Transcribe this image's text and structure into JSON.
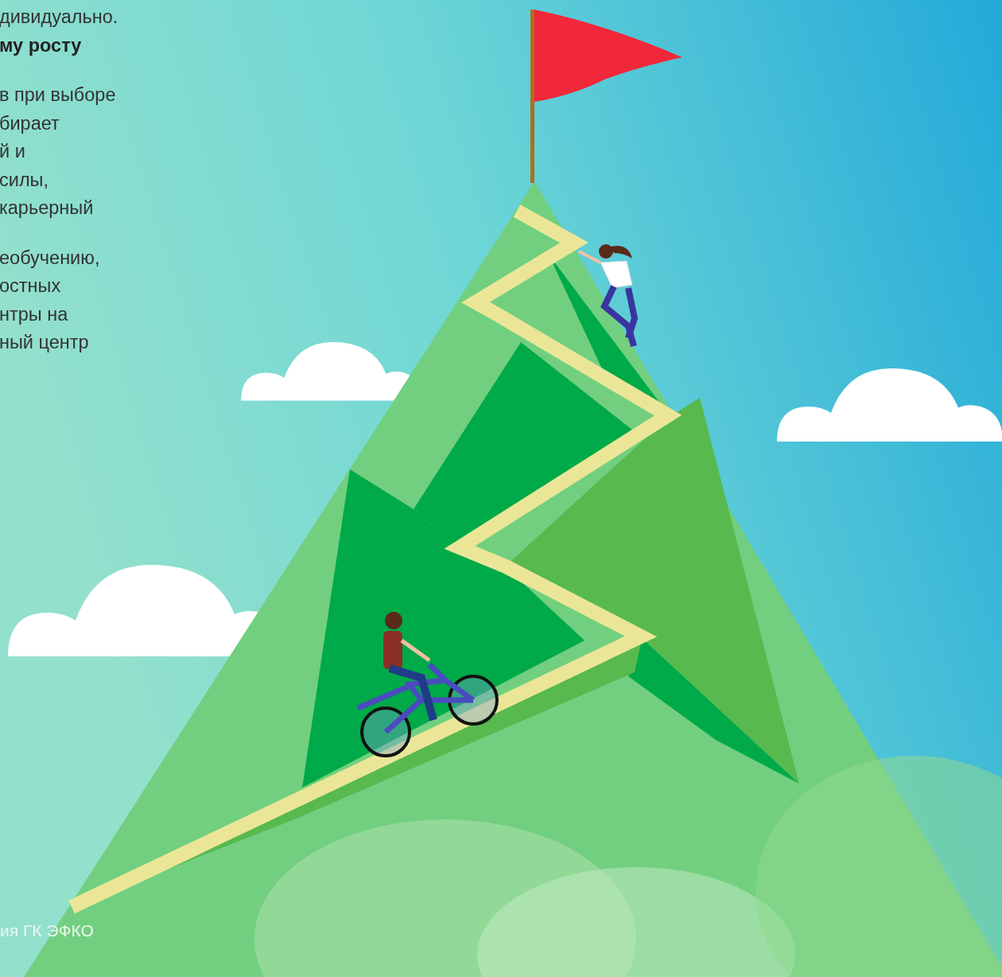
{
  "text_column": {
    "paragraphs": [
      {
        "lines": [
          "дивидуально.",
          "**му росту**"
        ]
      },
      {
        "lines": [
          "в при выборе",
          "бирает",
          "й и",
          "силы,",
          " карьерный"
        ]
      },
      {
        "lines": [
          "еобучению,",
          "остных",
          "нтры на",
          "ный центр"
        ]
      }
    ]
  },
  "footer": {
    "caption": "ия ГК ЭФКО"
  }
}
